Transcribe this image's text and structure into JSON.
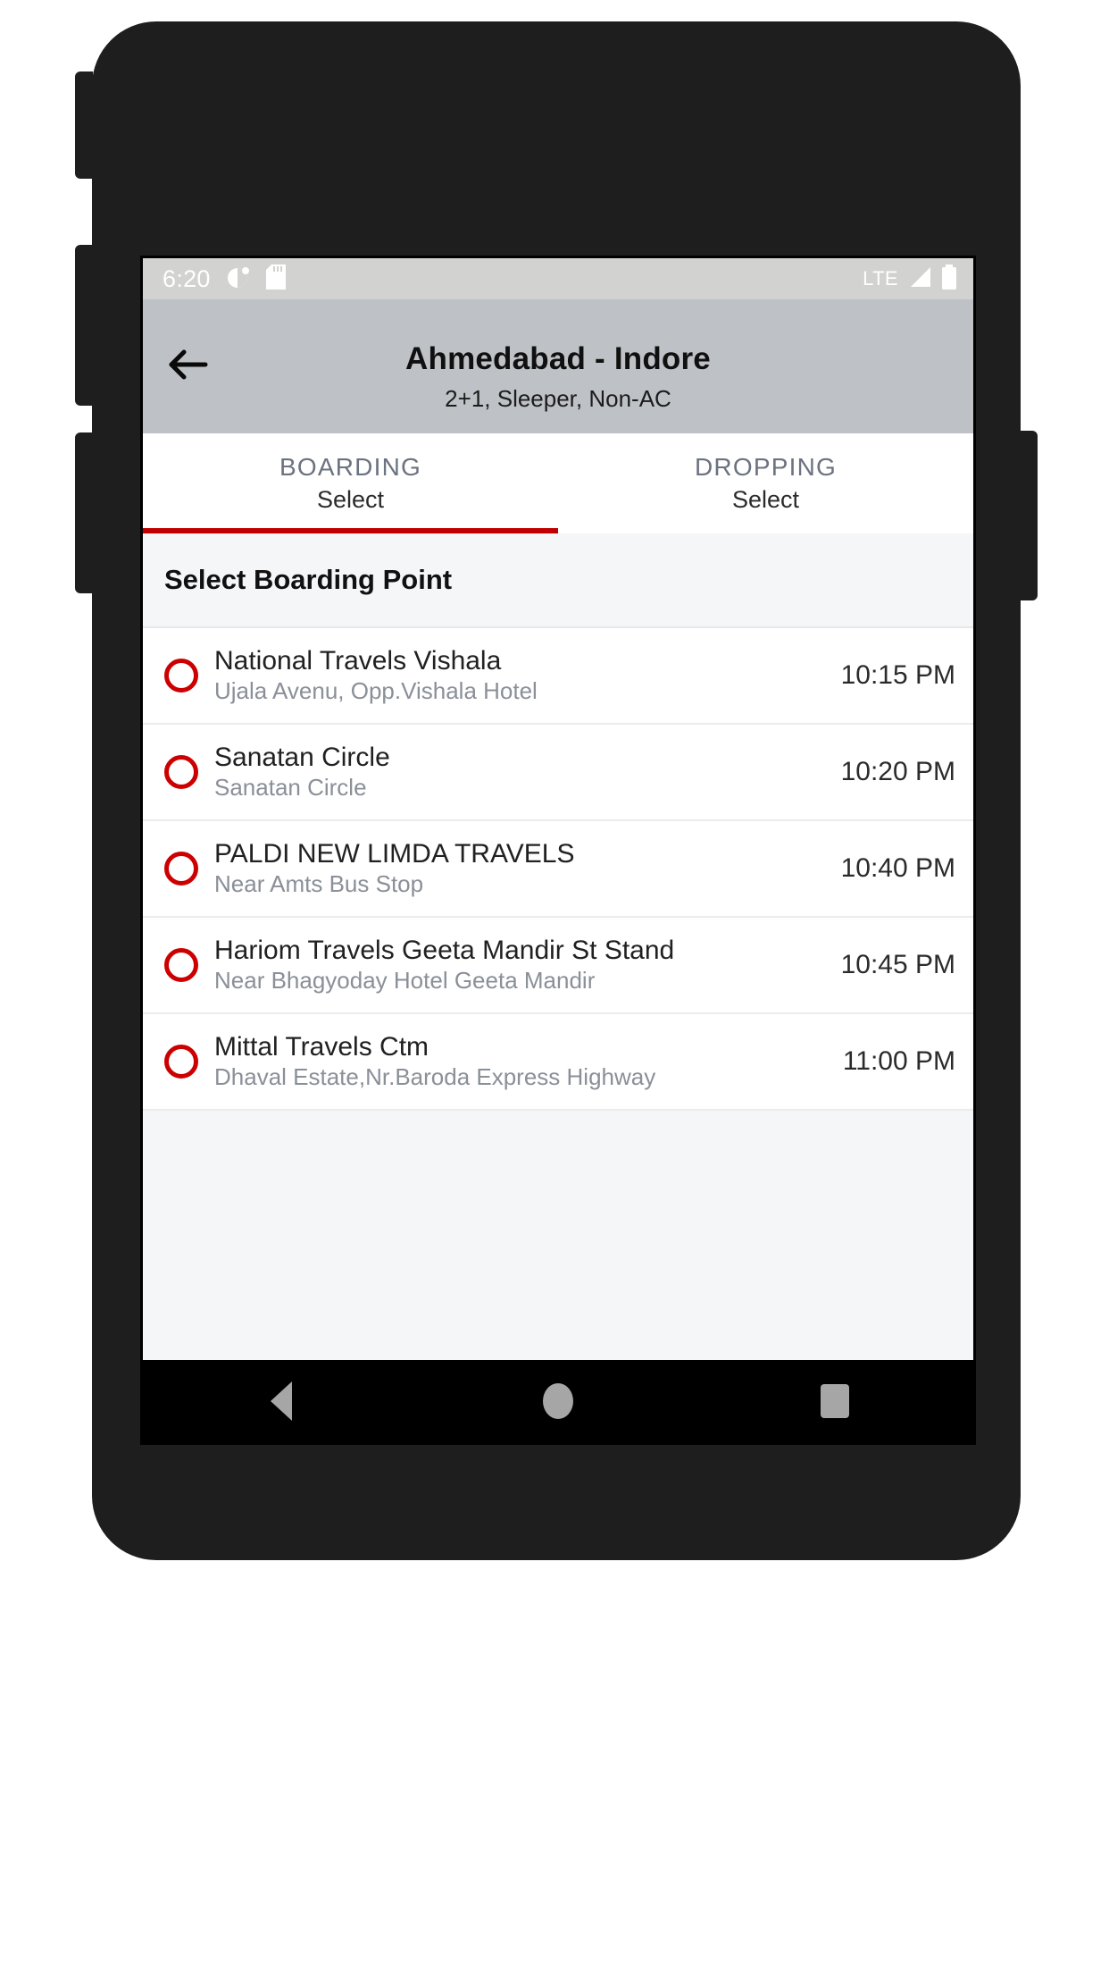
{
  "status_bar": {
    "time": "6:20",
    "icons_left": [
      "dnd-icon",
      "sd-card-icon"
    ],
    "network_label": "LTE",
    "icons_right": [
      "signal-icon",
      "battery-icon"
    ]
  },
  "app_bar": {
    "back_icon": "back-arrow-icon",
    "title": "Ahmedabad - Indore",
    "subtitle": "2+1, Sleeper, Non-AC",
    "background_color": "#bec1c5"
  },
  "tabs": {
    "active_index": 0,
    "indicator_color": "#c00000",
    "items": [
      {
        "title": "BOARDING",
        "value": "Select"
      },
      {
        "title": "DROPPING",
        "value": "Select"
      }
    ]
  },
  "section": {
    "header": "Select Boarding Point"
  },
  "boarding_points": [
    {
      "name": "National Travels Vishala",
      "landmark": "Ujala Avenu, Opp.Vishala Hotel",
      "time": "10:15 PM",
      "selected": false
    },
    {
      "name": "Sanatan Circle",
      "landmark": "Sanatan Circle",
      "time": "10:20 PM",
      "selected": false
    },
    {
      "name": "PALDI NEW LIMDA TRAVELS",
      "landmark": "Near Amts Bus Stop",
      "time": "10:40 PM",
      "selected": false
    },
    {
      "name": "Hariom Travels Geeta Mandir St Stand",
      "landmark": "Near Bhagyoday Hotel Geeta Mandir",
      "time": "10:45 PM",
      "selected": false
    },
    {
      "name": "Mittal Travels Ctm",
      "landmark": "Dhaval Estate,Nr.Baroda Express Highway",
      "time": "11:00 PM",
      "selected": false
    }
  ],
  "nav_bar": {
    "buttons": [
      "nav-back-icon",
      "nav-home-icon",
      "nav-recents-icon"
    ]
  },
  "theme": {
    "accent_red": "#cc0000",
    "radio_color": "#cc0000",
    "surface": "#ffffff",
    "section_bg": "#f5f6f8"
  }
}
